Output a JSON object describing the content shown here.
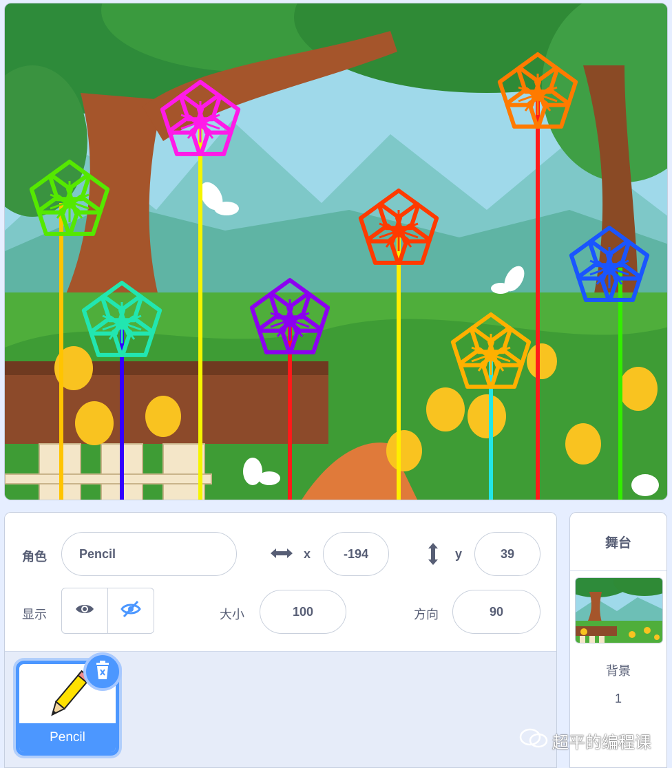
{
  "sprite_info": {
    "sprite_label": "角色",
    "sprite_name": "Pencil",
    "x_label": "x",
    "x_value": "-194",
    "y_label": "y",
    "y_value": "39",
    "show_label": "显示",
    "size_label": "大小",
    "size_value": "100",
    "direction_label": "方向",
    "direction_value": "90"
  },
  "sprite_list": [
    {
      "name": "Pencil",
      "selected": true
    }
  ],
  "stage_panel": {
    "title": "舞台",
    "backdrop_label": "背景",
    "backdrop_count": "1"
  },
  "watermark": {
    "text": "超平的编程课"
  },
  "colors": {
    "accent": "#4c97ff",
    "text": "#575e75"
  },
  "icons": [
    "arrows-horizontal-icon",
    "arrows-vertical-icon",
    "eye-icon",
    "eye-off-icon",
    "trash-icon",
    "pencil-icon",
    "wechat-icon"
  ]
}
